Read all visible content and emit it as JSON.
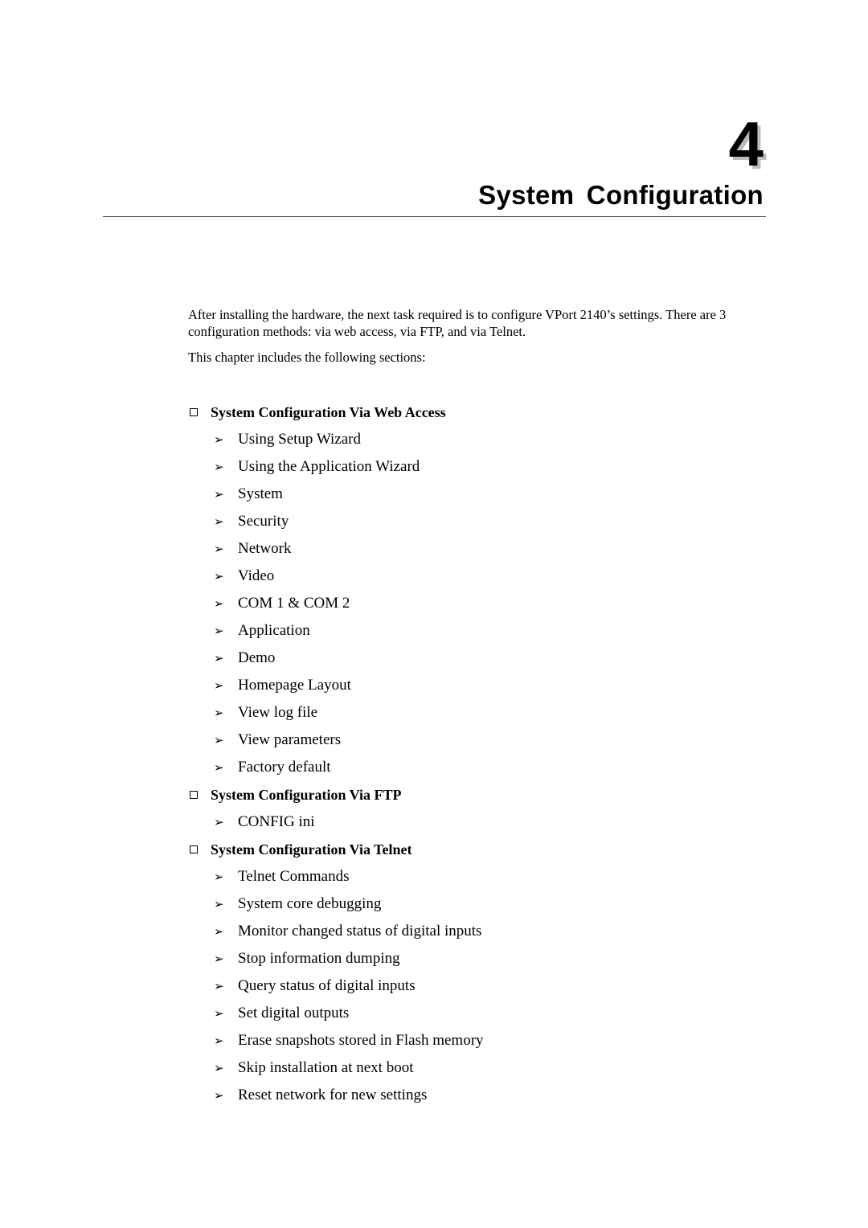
{
  "chapter": {
    "number": "4",
    "title": "System Configuration"
  },
  "intro": {
    "paragraph1": "After installing the hardware, the next task required is to configure VPort 2140’s settings. There are 3 configuration methods: via web access, via FTP, and via Telnet.",
    "paragraph2": "This chapter includes the following sections:"
  },
  "sections": [
    {
      "title": "System Configuration Via Web Access",
      "items": [
        "Using Setup Wizard",
        "Using the Application Wizard",
        "System",
        "Security",
        "Network",
        "Video",
        "COM 1 & COM 2",
        "Application",
        "Demo",
        "Homepage Layout",
        "View log file",
        "View parameters",
        "Factory default"
      ]
    },
    {
      "title": "System Configuration Via FTP",
      "items": [
        "CONFIG ini"
      ]
    },
    {
      "title": "System Configuration Via Telnet",
      "items": [
        "Telnet Commands",
        "System core debugging",
        "Monitor changed status of digital inputs",
        "Stop information dumping",
        "Query status of digital inputs",
        "Set digital outputs",
        "Erase snapshots stored in Flash memory",
        "Skip installation at next boot",
        "Reset network for new settings"
      ]
    }
  ],
  "icons": {
    "section_bullet": "checkbox-square-icon",
    "item_bullet": "arrowhead-icon",
    "arrow_glyph": "➢"
  }
}
